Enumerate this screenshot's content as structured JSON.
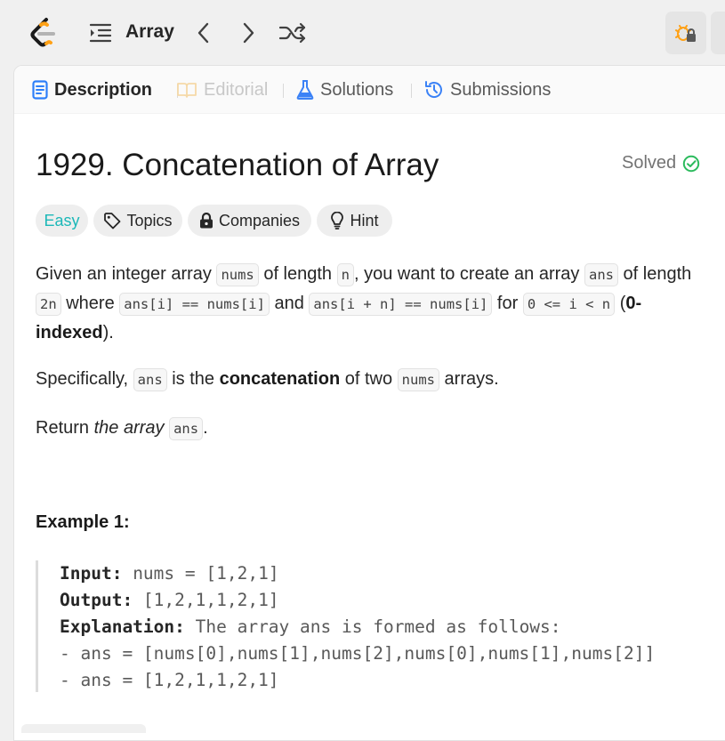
{
  "header": {
    "problem_list_title": "Array",
    "icons": [
      "leetcode-logo",
      "list-icon",
      "chevron-left-icon",
      "chevron-right-icon",
      "shuffle-icon",
      "debug-lock-icon"
    ]
  },
  "tabs": [
    {
      "label": "Description",
      "icon": "description-icon",
      "active": true
    },
    {
      "label": "Editorial",
      "icon": "book-icon",
      "disabled": true
    },
    {
      "label": "Solutions",
      "icon": "flask-icon"
    },
    {
      "label": "Submissions",
      "icon": "history-icon"
    }
  ],
  "problem": {
    "title": "1929. Concatenation of Array",
    "status": "Solved",
    "difficulty": "Easy",
    "tags": {
      "topics": "Topics",
      "companies": "Companies",
      "hint": "Hint"
    },
    "p1": {
      "t1": "Given an integer array ",
      "c1": "nums",
      "t2": " of length ",
      "c2": "n",
      "t3": ", you want to create an array ",
      "c3": "ans",
      "t4": " of length ",
      "c4": "2n",
      "t5": " where ",
      "c5": "ans[i] == nums[i]",
      "t6": " and ",
      "c6": "ans[i + n] == nums[i]",
      "t7": " for ",
      "c7": "0 <= i < n",
      "t8": " (",
      "b1": "0-indexed",
      "t9": ")."
    },
    "p2": {
      "t1": "Specifically, ",
      "c1": "ans",
      "t2": " is the ",
      "b1": "concatenation",
      "t3": " of two ",
      "c2": "nums",
      "t4": " arrays."
    },
    "p3": {
      "t1": "Return ",
      "i1": "the array",
      "t2": " ",
      "c1": "ans",
      "t3": "."
    },
    "example": {
      "heading": "Example 1:",
      "input_label": "Input:",
      "input_value": " nums = [1,2,1]",
      "output_label": "Output:",
      "output_value": " [1,2,1,1,2,1]",
      "explanation_label": "Explanation:",
      "explanation_value": " The array ans is formed as follows:",
      "line1": "- ans = [nums[0],nums[1],nums[2],nums[0],nums[1],nums[2]]",
      "line2": "- ans = [1,2,1,1,2,1]"
    }
  },
  "colors": {
    "easy": "#1cb8b8",
    "solved": "#2cbb5d",
    "accent_blue": "#3b82f6"
  }
}
